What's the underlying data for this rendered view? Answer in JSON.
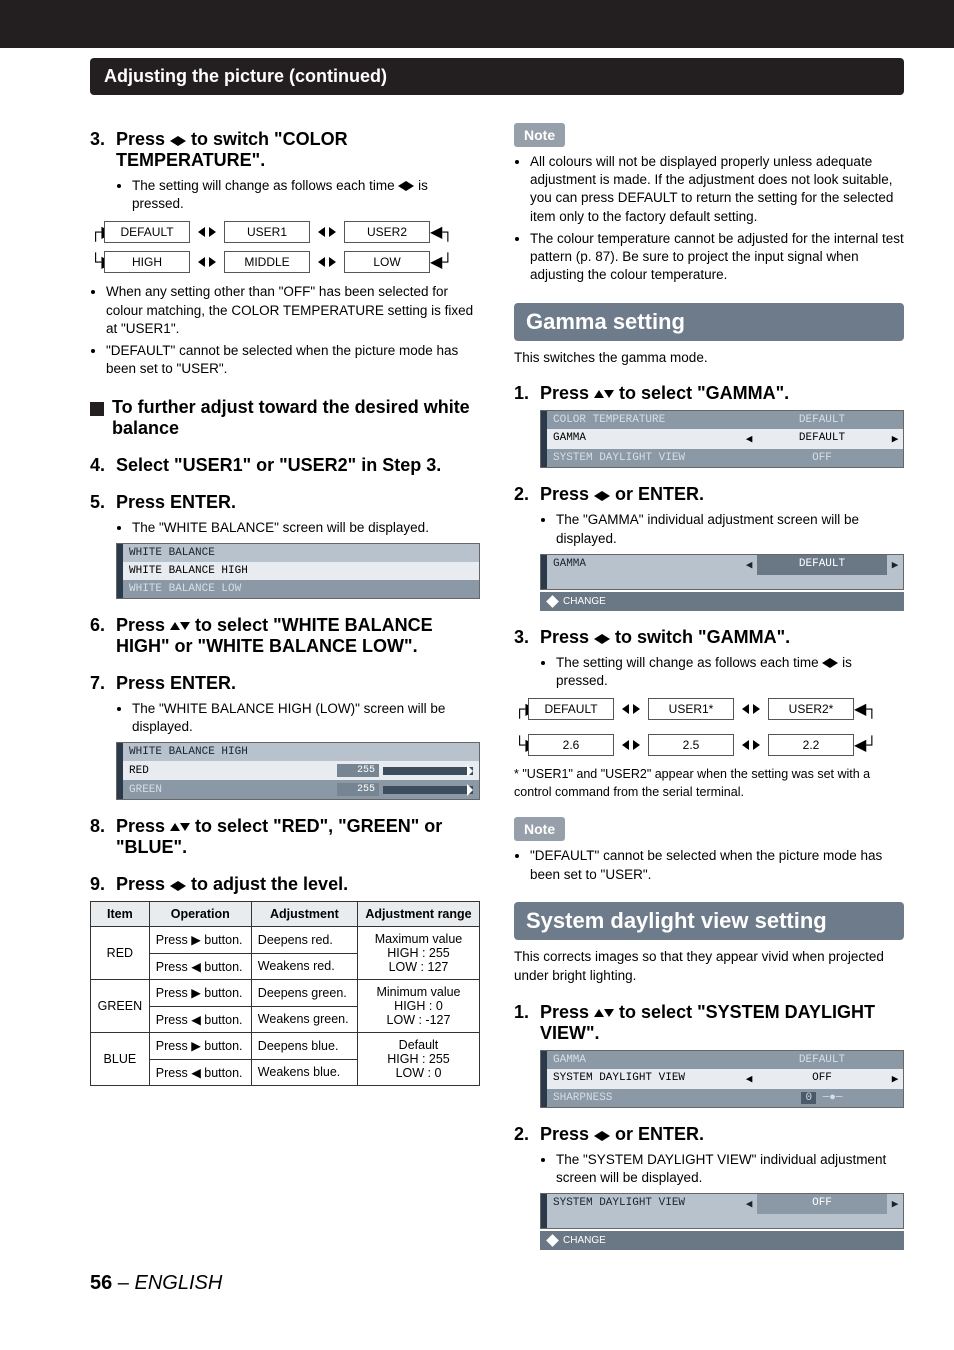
{
  "section_title": "Adjusting the picture (continued)",
  "left": {
    "step3": {
      "heading_prefix": "Press ",
      "heading_suffix": " to switch \"COLOR TEMPERATURE\".",
      "bullet1a": "The setting will change as follows each time ",
      "bullet1b": " is pressed."
    },
    "flow1": {
      "b1": "DEFAULT",
      "b2": "USER1",
      "b3": "USER2",
      "b4": "HIGH",
      "b5": "MIDDLE",
      "b6": "LOW"
    },
    "bullets_after_flow": [
      "When any setting other than \"OFF\" has been selected for colour matching, the COLOR TEMPERATURE setting is fixed at \"USER1\".",
      "\"DEFAULT\" cannot be selected when the picture mode has been set to \"USER\"."
    ],
    "sub_heading": "To further adjust toward the desired white balance",
    "step4": "Select \"USER1\" or \"USER2\" in Step 3.",
    "step5": {
      "heading": "Press ENTER.",
      "bullet": "The \"WHITE BALANCE\" screen will be displayed."
    },
    "wb_menu": {
      "r1": "WHITE BALANCE",
      "r2": "WHITE BALANCE HIGH",
      "r3": "WHITE BALANCE LOW"
    },
    "step6_prefix": "Press ",
    "step6_suffix": " to select \"WHITE BALANCE HIGH\" or \"WHITE BALANCE LOW\".",
    "step7": {
      "heading": "Press ENTER.",
      "bullet": "The \"WHITE BALANCE HIGH (LOW)\" screen will be displayed."
    },
    "wbh_menu": {
      "title": "WHITE BALANCE HIGH",
      "r1": "RED",
      "v1": "255",
      "r2": "GREEN",
      "v2": "255"
    },
    "step8_prefix": "Press ",
    "step8_suffix": " to select \"RED\", \"GREEN\" or \"BLUE\".",
    "step9_prefix": "Press ",
    "step9_suffix": " to adjust the level.",
    "table": {
      "headers": [
        "Item",
        "Operation",
        "Adjustment",
        "Adjustment range"
      ],
      "rows": [
        {
          "item": "RED",
          "ops": [
            "Press ▶ button.",
            "Press ◀ button."
          ],
          "adj": [
            "Deepens red.",
            "Weakens red."
          ]
        },
        {
          "item": "GREEN",
          "ops": [
            "Press ▶ button.",
            "Press ◀ button."
          ],
          "adj": [
            "Deepens green.",
            "Weakens green."
          ]
        },
        {
          "item": "BLUE",
          "ops": [
            "Press ▶ button.",
            "Press ◀ button."
          ],
          "adj": [
            "Deepens blue.",
            "Weakens blue."
          ]
        }
      ],
      "range": {
        "max_label": "Maximum value",
        "max_high": "HIGH : 255",
        "max_low": "LOW : 127",
        "min_label": "Minimum value",
        "min_high": "HIGH : 0",
        "min_low": "LOW : -127",
        "def_label": "Default",
        "def_high": "HIGH : 255",
        "def_low": "LOW : 0"
      }
    }
  },
  "right": {
    "note_label": "Note",
    "note_bullets": [
      "All colours will not be displayed properly unless adequate adjustment is made. If the adjustment does not look suitable, you can press DEFAULT to return the setting for the selected item only to the factory default setting.",
      "The colour temperature cannot be adjusted for the internal test pattern (p. 87). Be sure to project the input signal when adjusting the colour temperature."
    ],
    "gamma": {
      "title": "Gamma setting",
      "intro": "This switches the gamma mode.",
      "step1_prefix": "Press ",
      "step1_suffix": " to select \"GAMMA\".",
      "menu1": {
        "r1_label": "COLOR TEMPERATURE",
        "r1_value": "DEFAULT",
        "r2_label": "GAMMA",
        "r2_value": "DEFAULT",
        "r3_label": "SYSTEM DAYLIGHT VIEW",
        "r3_value": "OFF"
      },
      "step2_prefix": "Press ",
      "step2_suffix": " or ENTER.",
      "step2_bullet": "The \"GAMMA\" individual adjustment screen will be displayed.",
      "menu2": {
        "label": "GAMMA",
        "value": "DEFAULT",
        "change": "CHANGE"
      },
      "step3_prefix": "Press ",
      "step3_suffix": " to switch \"GAMMA\".",
      "step3_bullet_a": "The setting will change as follows each time ",
      "step3_bullet_b": " is pressed.",
      "flow": {
        "b1": "DEFAULT",
        "b2": "USER1*",
        "b3": "USER2*",
        "b4": "2.6",
        "b5": "2.5",
        "b6": "2.2"
      },
      "footnote": "\"USER1\" and \"USER2\" appear when the setting was set with a control command from the serial terminal.",
      "note2": "\"DEFAULT\" cannot be selected when the picture mode has been set to \"USER\"."
    },
    "sdv": {
      "title": "System daylight view setting",
      "intro": "This corrects images so that they appear vivid when projected under bright lighting.",
      "step1_prefix": "Press ",
      "step1_suffix": " to select \"SYSTEM DAYLIGHT VIEW\".",
      "menu1": {
        "r1_label": "GAMMA",
        "r1_value": "DEFAULT",
        "r2_label": "SYSTEM DAYLIGHT VIEW",
        "r2_value": "OFF",
        "r3_label": "SHARPNESS",
        "r3_value": "0"
      },
      "step2_prefix": "Press ",
      "step2_suffix": " or ENTER.",
      "step2_bullet": "The \"SYSTEM DAYLIGHT VIEW\" individual adjustment screen will be displayed.",
      "menu2": {
        "label": "SYSTEM DAYLIGHT VIEW",
        "value": "OFF",
        "change": "CHANGE"
      }
    }
  },
  "page_number": "56",
  "page_lang": "ENGLISH"
}
